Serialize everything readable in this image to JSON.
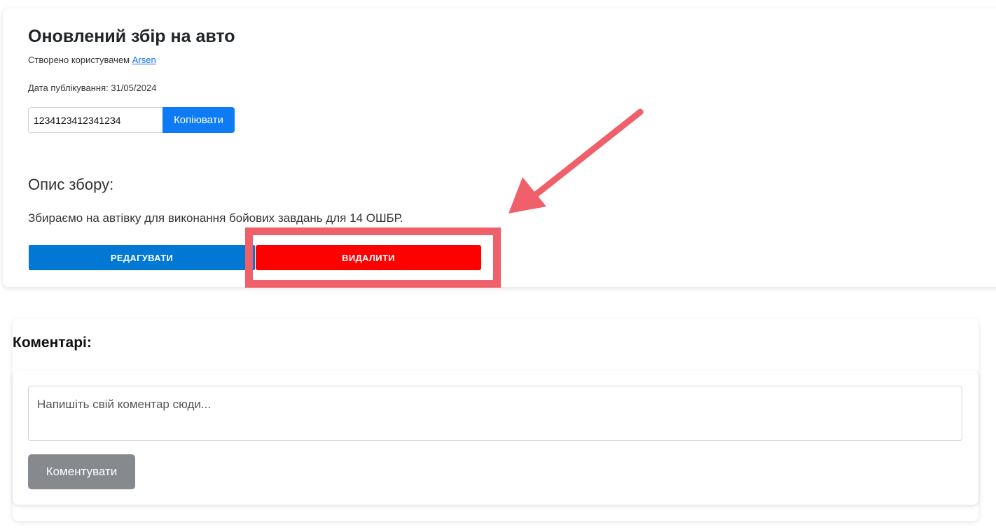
{
  "fundraiser": {
    "title": "Оновлений збір на авто",
    "author_prefix": "Створено користувачем",
    "author_name": "Arsen",
    "date_text": "Дата публікування: 31/05/2024",
    "card_number": "1234123412341234",
    "copy_label": "Копіювати",
    "description_heading": "Опис збору:",
    "description_text": "Збираємо на автівку для виконання бойових завдань для 14 ОШБР.",
    "edit_label": "РЕДАГУВАТИ",
    "delete_label": "ВИДАЛИТИ"
  },
  "comments": {
    "title": "Коментарі:",
    "placeholder": "Напишіть свій коментар сюди...",
    "submit_label": "Коментувати"
  },
  "colors": {
    "copy_button": "#0d7bf4",
    "edit_button": "#0078d4",
    "delete_button": "#ff0000",
    "annotation": "#f0606a",
    "comment_button": "#868a8e"
  }
}
